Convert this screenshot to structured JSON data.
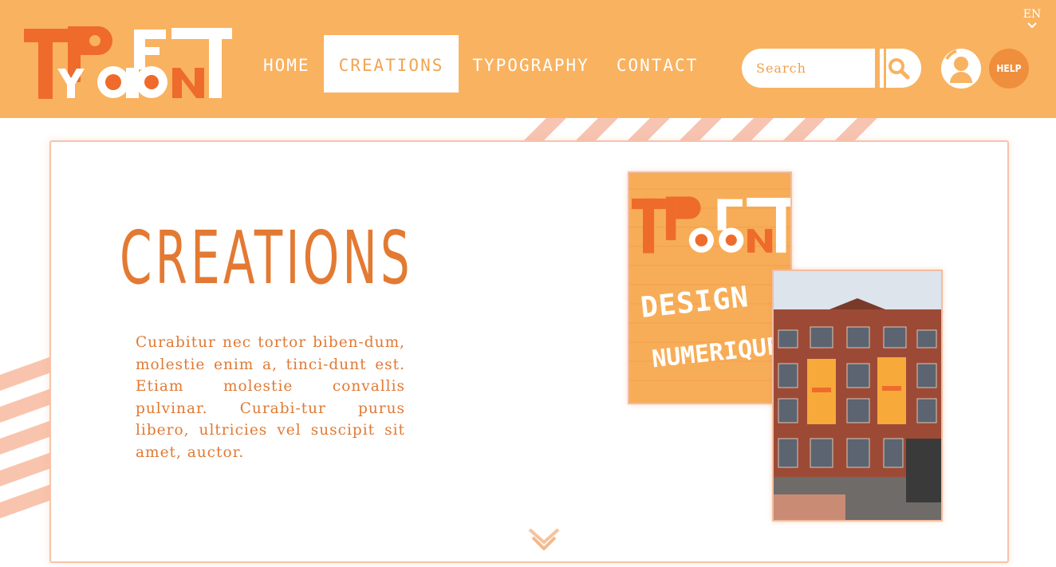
{
  "language": "EN",
  "nav": {
    "items": [
      {
        "label": "HOME"
      },
      {
        "label": "CREATIONS"
      },
      {
        "label": "TYPOGRAPHY"
      },
      {
        "label": "CONTACT"
      }
    ],
    "active_index": 1
  },
  "search": {
    "placeholder": "Search"
  },
  "help_label": "HELP",
  "main": {
    "title": "CREATIONS",
    "paragraph": "Curabitur nec tortor biben-dum, molestie enim a, tinci-dunt est. Etiam molestie convallis pulvinar. Curabi-tur purus libero, ultricies vel suscipit sit amet, auctor."
  },
  "poster": {
    "lines": [
      "DESIGN",
      "NUMERIQUE"
    ]
  },
  "colors": {
    "header_bg": "#f9b260",
    "accent": "#e37a33",
    "logo_orange": "#ee6b2c",
    "stripe": "#f7c4b1"
  }
}
